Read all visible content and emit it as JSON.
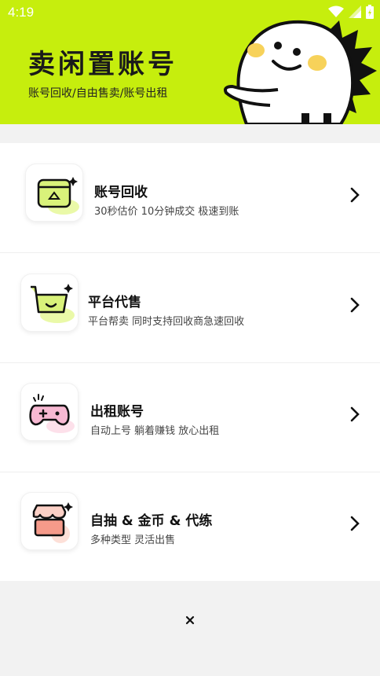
{
  "status_bar": {
    "time": "4:19"
  },
  "header": {
    "title": "卖闲置账号",
    "subtitle": "账号回收/自由售卖/账号出租"
  },
  "menu": [
    {
      "title": "账号回收",
      "desc": "30秒估价 10分钟成交 极速到账",
      "icon": "recycle-box-icon"
    },
    {
      "title": "平台代售",
      "desc": "平台帮卖 同时支持回收商急速回收",
      "icon": "shopping-cart-icon"
    },
    {
      "title": "出租账号",
      "desc": "自动上号 躺着赚钱 放心出租",
      "icon": "gamepad-icon"
    },
    {
      "title": "自抽 & 金币 & 代练",
      "desc": "多种类型 灵活出售",
      "icon": "shop-icon"
    }
  ],
  "colors": {
    "brand": "#c6ee0d",
    "background": "#f2f2f2"
  }
}
